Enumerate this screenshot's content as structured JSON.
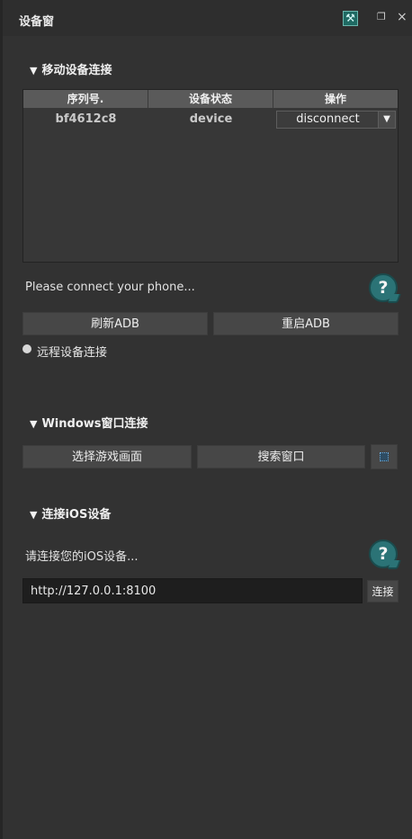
{
  "window": {
    "title": "设备窗",
    "tool_icon": "tools-icon",
    "restore_icon": "restore-icon",
    "close_icon": "close-icon"
  },
  "mobile": {
    "section_title": "移动设备连接",
    "table": {
      "headers": [
        "序列号.",
        "设备状态",
        "操作"
      ],
      "rows": [
        {
          "serial": "bf4612c8",
          "status": "device",
          "action": "disconnect"
        }
      ]
    },
    "status_text": "Please connect your phone...",
    "refresh_adb": "刷新ADB",
    "restart_adb": "重启ADB",
    "remote_label": "远程设备连接"
  },
  "windows": {
    "section_title": "Windows窗口连接",
    "select_game": "选择游戏画面",
    "search_window": "搜索窗口",
    "pick_icon": "window-picker-icon"
  },
  "ios": {
    "section_title": "连接iOS设备",
    "status_text": "请连接您的iOS设备...",
    "url_value": "http://127.0.0.1:8100",
    "connect": "连接"
  },
  "colors": {
    "panel_bg": "#323232",
    "button_bg": "#474747",
    "help_accent": "#2b7376",
    "header_bg": "#5a5a5a"
  }
}
